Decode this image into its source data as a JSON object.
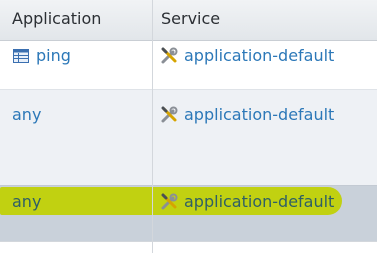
{
  "columns": {
    "application": "Application",
    "service": "Service"
  },
  "rows": [
    {
      "application": "ping",
      "application_icon": "table-icon",
      "service": "application-default",
      "service_icon": "tools-icon"
    },
    {
      "application": "any",
      "service": "application-default",
      "service_icon": "tools-icon"
    },
    {
      "application": "any",
      "service": "application-default",
      "service_icon": "tools-icon",
      "highlighted": true
    }
  ],
  "colors": {
    "link": "#2c78b8",
    "highlight": "#c0d000",
    "selected_row": "#c9d1da"
  }
}
